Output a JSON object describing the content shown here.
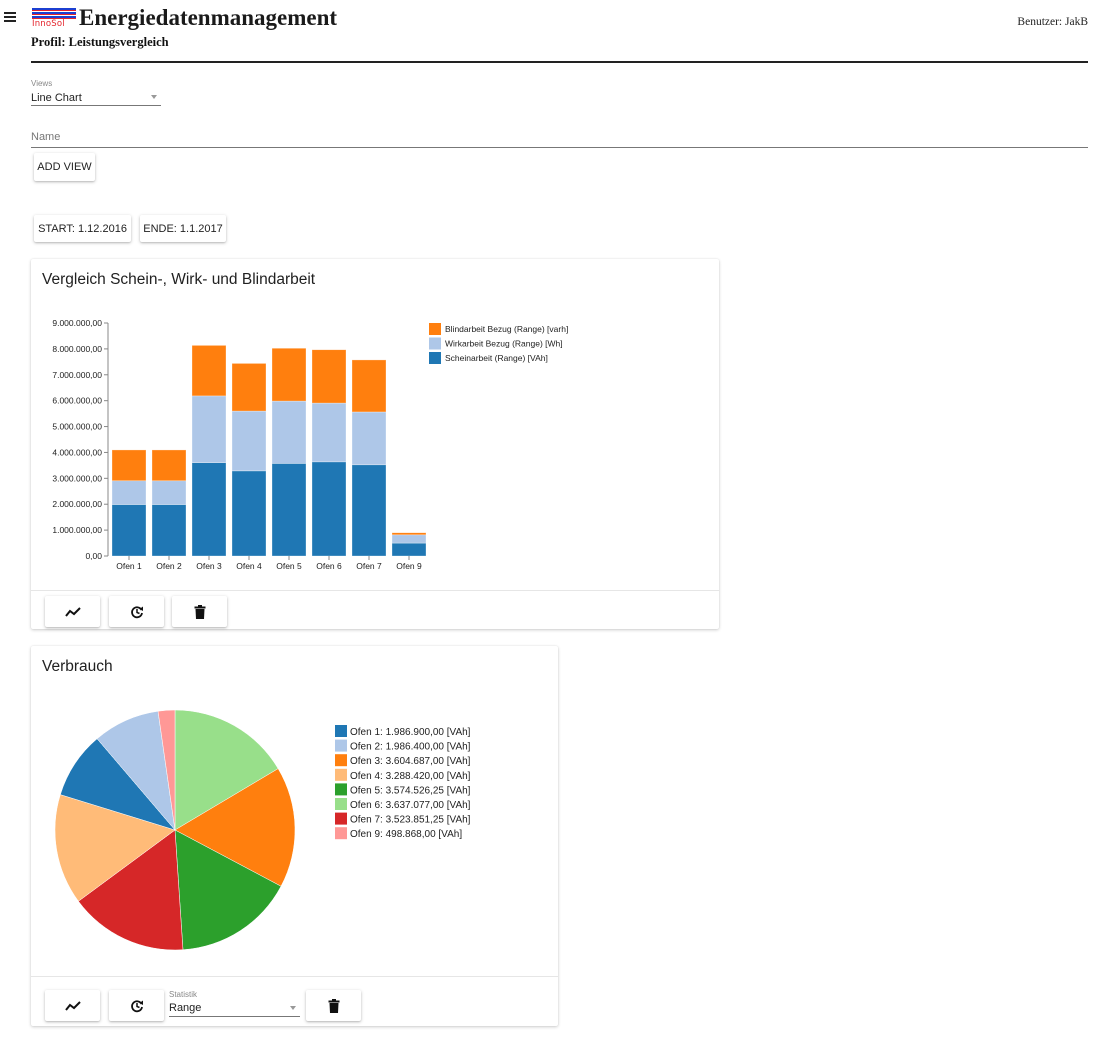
{
  "header": {
    "menu_icon": "hamburger-menu-icon",
    "logo_top": "mts",
    "logo_bottom": "InnoSol",
    "app_title": "Energiedatenmanagement",
    "profile": "Profil: Leistungsvergleich",
    "user": "Benutzer: JakB"
  },
  "views": {
    "label": "Views",
    "selected": "Line Chart"
  },
  "name_field": {
    "placeholder": "Name",
    "value": ""
  },
  "add_view_label": "ADD VIEW",
  "date_range": {
    "start_label": "START: 1.12.2016",
    "end_label": "ENDE: 1.1.2017"
  },
  "cards": [
    {
      "title": "Vergleich Schein-, Wirk- und Blindarbeit",
      "actions": [
        "line-chart-icon",
        "history-icon",
        "delete-icon"
      ]
    },
    {
      "title": "Verbrauch",
      "actions": [
        "line-chart-icon",
        "history-icon",
        "delete-icon"
      ],
      "statistic": {
        "label": "Statistik",
        "selected": "Range"
      }
    }
  ],
  "chart_data": [
    {
      "type": "bar",
      "stacked": true,
      "title": "Vergleich Schein-, Wirk- und Blindarbeit",
      "xlabel": "",
      "ylabel": "",
      "categories": [
        "Ofen 1",
        "Ofen 2",
        "Ofen 3",
        "Ofen 4",
        "Ofen 5",
        "Ofen 6",
        "Ofen 7",
        "Ofen 9"
      ],
      "ylim": [
        0,
        9000000
      ],
      "yticks": [
        0,
        1000000,
        2000000,
        3000000,
        4000000,
        5000000,
        6000000,
        7000000,
        8000000,
        9000000
      ],
      "ytick_labels": [
        "0,00",
        "1.000.000,00",
        "2.000.000,00",
        "3.000.000,00",
        "4.000.000,00",
        "5.000.000,00",
        "6.000.000,00",
        "7.000.000,00",
        "8.000.000,00",
        "9.000.000,00"
      ],
      "grid": false,
      "legend_position": "top-right",
      "series": [
        {
          "name": "Scheinarbeit (Range) [VAh]",
          "color": "#1f77b4",
          "values": [
            1986900,
            1986400,
            3604687,
            3288420,
            3574526.25,
            3637077,
            3523851.25,
            498868
          ]
        },
        {
          "name": "Wirkarbeit Bezug (Range) [Wh]",
          "color": "#aec7e8",
          "values": [
            920000,
            920000,
            2580000,
            2310000,
            2410000,
            2270000,
            2040000,
            320000
          ]
        },
        {
          "name": "Blindarbeit Bezug (Range) [varh]",
          "color": "#ff7f0e",
          "values": [
            1190000,
            1190000,
            1950000,
            1840000,
            2040000,
            2060000,
            2010000,
            80000
          ]
        }
      ],
      "legend_order": [
        "Blindarbeit Bezug (Range) [varh]",
        "Wirkarbeit Bezug (Range) [Wh]",
        "Scheinarbeit (Range) [VAh]"
      ]
    },
    {
      "type": "pie",
      "title": "Verbrauch",
      "unit": "[VAh]",
      "legend_position": "right",
      "sort": "descending",
      "slices": [
        {
          "label": "Ofen 1",
          "value": 1986900.0,
          "display": "1.986.900,00",
          "color": "#1f77b4"
        },
        {
          "label": "Ofen 2",
          "value": 1986400.0,
          "display": "1.986.400,00",
          "color": "#aec7e8"
        },
        {
          "label": "Ofen 3",
          "value": 3604687.0,
          "display": "3.604.687,00",
          "color": "#ff7f0e"
        },
        {
          "label": "Ofen 4",
          "value": 3288420.0,
          "display": "3.288.420,00",
          "color": "#ffbb78"
        },
        {
          "label": "Ofen 5",
          "value": 3574526.25,
          "display": "3.574.526,25",
          "color": "#2ca02c"
        },
        {
          "label": "Ofen 6",
          "value": 3637077.0,
          "display": "3.637.077,00",
          "color": "#98df8a"
        },
        {
          "label": "Ofen 7",
          "value": 3523851.25,
          "display": "3.523.851,25",
          "color": "#d62728"
        },
        {
          "label": "Ofen 9",
          "value": 498868.0,
          "display": "498.868,00",
          "color": "#ff9896"
        }
      ]
    }
  ]
}
